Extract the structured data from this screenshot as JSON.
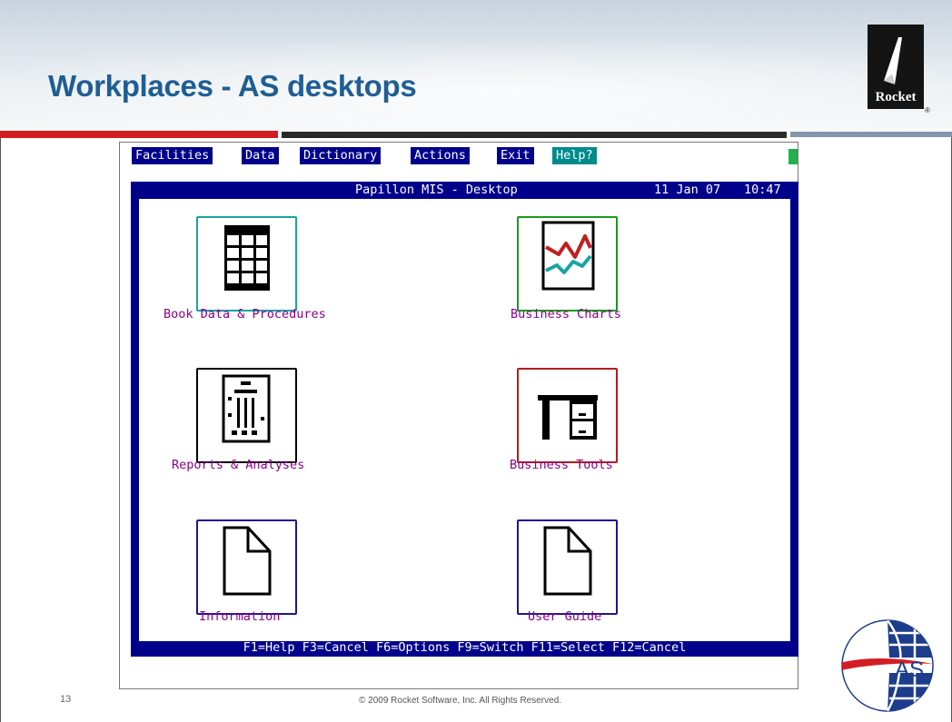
{
  "slide": {
    "title": "Workplaces - AS desktops",
    "page_number": "13",
    "copyright": "© 2009 Rocket Software, Inc. All Rights Reserved.",
    "logo_text": "Rocket",
    "registered_mark": "®",
    "secondary_logo_text": "AS"
  },
  "colors": {
    "title_blue": "#1f5e94",
    "rule_red": "#d21e23",
    "terminal_blue": "#00008b",
    "help_teal": "#008b8b",
    "label_magenta": "#8b008b",
    "cursor_green": "#22b14c"
  },
  "menubar": {
    "items": [
      "Facilities",
      "Data",
      "Dictionary",
      "Actions",
      "Exit",
      "Help?"
    ]
  },
  "window": {
    "title": "Papillon MIS - Desktop",
    "date": "11 Jan 07",
    "time": "10:47"
  },
  "desktop_icons": [
    {
      "label": "Book Data & Procedures",
      "icon": "spreadsheet-icon",
      "border_color": "#1aa3a3"
    },
    {
      "label": "Business Charts",
      "icon": "line-chart-icon",
      "border_color": "#1a9a1a"
    },
    {
      "label": "Reports & Analyses",
      "icon": "report-icon",
      "border_color": "#000000"
    },
    {
      "label": "Business Tools",
      "icon": "desk-icon",
      "border_color": "#b01e1e"
    },
    {
      "label": "Information",
      "icon": "document-icon",
      "border_color": "#1a1a8b"
    },
    {
      "label": "User Guide",
      "icon": "document-icon",
      "border_color": "#1a1a8b"
    }
  ],
  "function_keys": "F1=Help F3=Cancel F6=Options F9=Switch F11=Select F12=Cancel"
}
